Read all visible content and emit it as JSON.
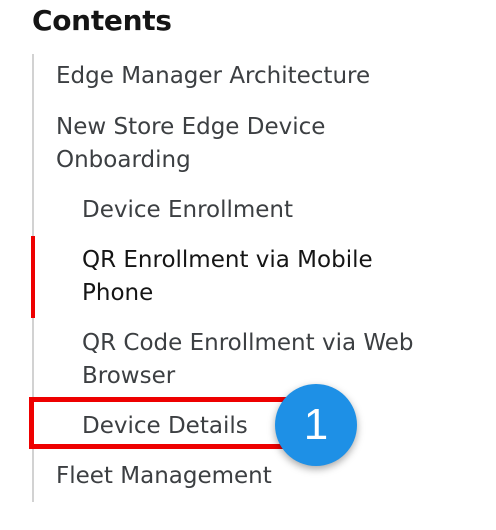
{
  "toc": {
    "title": "Contents",
    "items": [
      {
        "label": "Edge Manager Architecture"
      },
      {
        "label": "New Store Edge Device"
      },
      {
        "label": "Onboarding"
      },
      {
        "label": "Device Enrollment"
      },
      {
        "label": "QR Enrollment via Mobile"
      },
      {
        "label": "Phone"
      },
      {
        "label": "QR Code Enrollment via Web"
      },
      {
        "label": "Browser"
      },
      {
        "label": "Device Details"
      },
      {
        "label": "Fleet Management"
      }
    ],
    "active_item": "QR Enrollment via Mobile Phone"
  },
  "callout": {
    "number": "1"
  },
  "colors": {
    "accent": "#ee0000",
    "badge": "#1e90e6",
    "nav_border": "#d2d2d2"
  }
}
